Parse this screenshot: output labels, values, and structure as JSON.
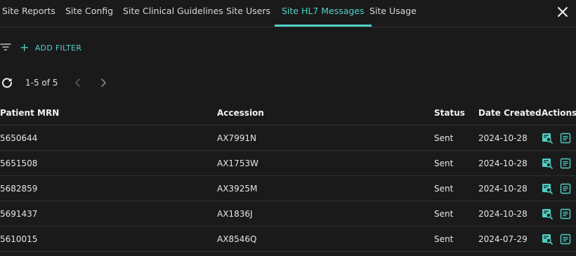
{
  "tabs": [
    {
      "label": "Site Reports",
      "active": false
    },
    {
      "label": "Site Config",
      "active": false
    },
    {
      "label": "Site Clinical Guidelines",
      "active": false
    },
    {
      "label": "Site Users",
      "active": false
    },
    {
      "label": "Site HL7 Messages",
      "active": true
    },
    {
      "label": "Site Usage",
      "active": false
    }
  ],
  "toolbar": {
    "add_filter_label": "ADD FILTER"
  },
  "pagination": {
    "range_label": "1-5 of 5"
  },
  "table": {
    "columns": [
      "Patient MRN",
      "Accession",
      "Status",
      "Date Created",
      "Actions"
    ],
    "rows": [
      {
        "mrn": "5650644",
        "accession": "AX7991N",
        "status": "Sent",
        "date": "2024-10-28"
      },
      {
        "mrn": "5651508",
        "accession": "AX1753W",
        "status": "Sent",
        "date": "2024-10-28"
      },
      {
        "mrn": "5682859",
        "accession": "AX3925M",
        "status": "Sent",
        "date": "2024-10-28"
      },
      {
        "mrn": "5691437",
        "accession": "AX1836J",
        "status": "Sent",
        "date": "2024-10-28"
      },
      {
        "mrn": "5610015",
        "accession": "AX8546Q",
        "status": "Sent",
        "date": "2024-07-29"
      }
    ]
  },
  "colors": {
    "background": "#1a1a1a",
    "accent": "#4fd1c5",
    "text": "#e6e6e6",
    "divider": "#303030"
  },
  "icons": {
    "close": "close-icon",
    "filter": "filter-list-icon",
    "add": "plus-icon",
    "refresh": "refresh-icon",
    "prev": "chevron-left-icon",
    "next": "chevron-right-icon",
    "view_message": "message-search-icon",
    "details": "document-lines-icon"
  }
}
